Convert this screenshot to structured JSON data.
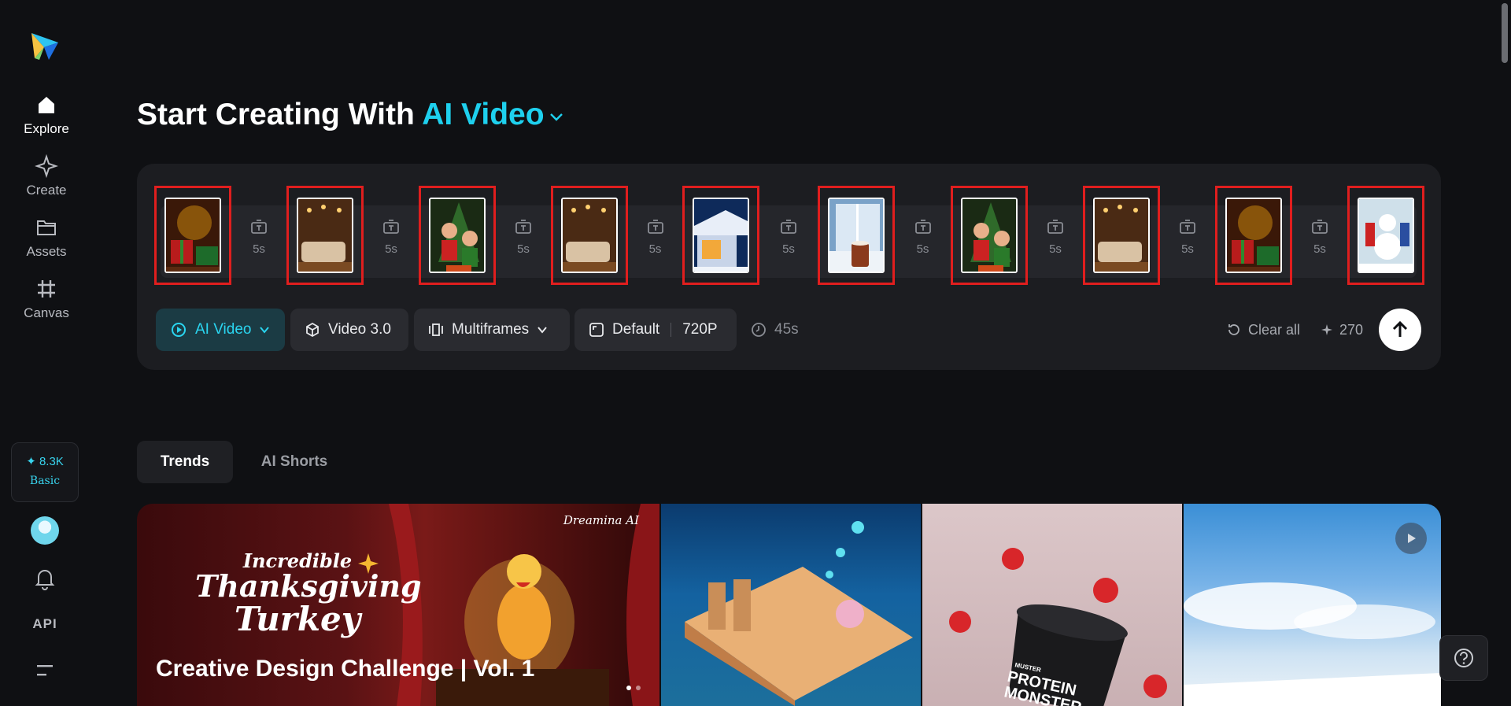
{
  "sidebar": {
    "logo_icon": "paper-plane-logo",
    "nav": [
      {
        "label": "Explore",
        "icon": "home-icon",
        "active": true
      },
      {
        "label": "Create",
        "icon": "diamond-icon",
        "active": false
      },
      {
        "label": "Assets",
        "icon": "folder-icon",
        "active": false
      },
      {
        "label": "Canvas",
        "icon": "canvas-icon",
        "active": false
      }
    ],
    "credits": {
      "amount": "✦ 8.3K",
      "plan": "Basic"
    },
    "api_label": "API"
  },
  "header": {
    "title_prefix": "Start Creating With ",
    "title_mode": "AI Video"
  },
  "frames": {
    "items": [
      {
        "scene": "gifts-tree"
      },
      {
        "scene": "cozy-room"
      },
      {
        "scene": "family-tree"
      },
      {
        "scene": "cozy-room"
      },
      {
        "scene": "merry-christmas-house"
      },
      {
        "scene": "hot-cocoa-window"
      },
      {
        "scene": "family-tree"
      },
      {
        "scene": "cozy-room"
      },
      {
        "scene": "gifts-tree"
      },
      {
        "scene": "snowman-kids"
      }
    ],
    "gaps": [
      "5s",
      "5s",
      "5s",
      "5s",
      "5s",
      "5s",
      "5s",
      "5s",
      "5s"
    ]
  },
  "toolbar": {
    "mode": "AI Video",
    "model": "Video 3.0",
    "frame_mode": "Multiframes",
    "ratio": "Default",
    "resolution": "720P",
    "duration": "45s",
    "clear_label": "Clear all",
    "cost": "270"
  },
  "tabs": [
    {
      "label": "Trends",
      "active": true
    },
    {
      "label": "AI Shorts",
      "active": false
    }
  ],
  "gallery": {
    "featured": {
      "title": "Creative Design Challenge | Vol. 1",
      "brand": "Dreamina AI",
      "headline_1": "Incredible",
      "headline_2": "Thanksgiving",
      "headline_3": "Turkey"
    },
    "product_label_1": "MUSTER",
    "product_label_2": "PROTEIN",
    "product_label_3": "MONSTER"
  },
  "colors": {
    "accent": "#1ed0ee",
    "frame_border": "#e01e1e",
    "background": "#0f1013",
    "panel": "#1c1d21"
  }
}
